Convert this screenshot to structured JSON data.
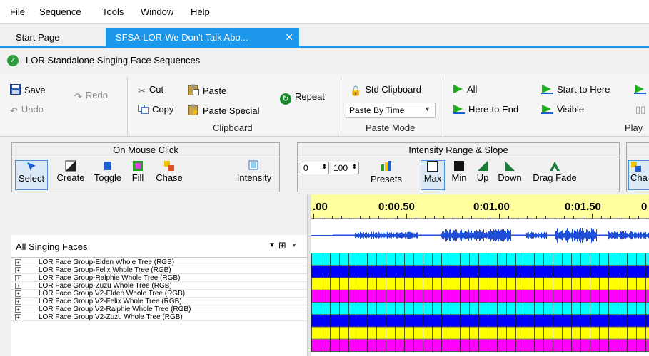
{
  "menu": [
    "File",
    "Sequence",
    "Tools",
    "Window",
    "Help"
  ],
  "tabs": {
    "start": "Start Page",
    "active": "SFSA-LOR-We Don't Talk Abo...",
    "close": "✕"
  },
  "title": "LOR Standalone Singing Face Sequences",
  "ribbon": {
    "save": "Save",
    "undo": "Undo",
    "redo": "Redo",
    "cut": "Cut",
    "copy": "Copy",
    "paste": "Paste",
    "paste_special": "Paste Special",
    "repeat": "Repeat",
    "clipboard_group": "Clipboard",
    "std_clipboard": "Std Clipboard",
    "paste_mode_value": "Paste By Time",
    "paste_mode_group": "Paste Mode",
    "play_all": "All",
    "start_to_here": "Start-to Here",
    "here_to_end": "Here-to End",
    "visible": "Visible",
    "play_group": "Play"
  },
  "mouse_click": {
    "header": "On Mouse Click",
    "select": "Select",
    "create": "Create",
    "toggle": "Toggle",
    "fill": "Fill",
    "chase": "Chase",
    "intensity": "Intensity"
  },
  "intensity_range": {
    "header": "Intensity Range & Slope",
    "low_value": "0",
    "high_value": "100",
    "presets": "Presets",
    "max": "Max",
    "min": "Min",
    "up": "Up",
    "down": "Down",
    "drag_fade": "Drag Fade"
  },
  "right_cut_label": "Cha",
  "faces": {
    "selector": "All Singing Faces",
    "rows": [
      "LOR Face Group-Elden Whole Tree (RGB)",
      "LOR Face Group-Felix Whole Tree (RGB)",
      "LOR Face Group-Ralphie Whole Tree (RGB)",
      "LOR Face Group-Zuzu Whole Tree (RGB)",
      "LOR Face Group V2-Elden Whole Tree (RGB)",
      "LOR Face Group V2-Felix Whole Tree (RGB)",
      "LOR Face Group V2-Ralphie Whole Tree (RGB)",
      "LOR Face Group V2-Zuzu Whole Tree (RGB)"
    ],
    "row_colors": [
      "#00ffff",
      "#0000ff",
      "#ffff00",
      "#ff00ff",
      "#00ffff",
      "#0000ff",
      "#ffff00",
      "#ff00ff"
    ]
  },
  "ruler_labels": [
    ".00",
    "0:00.50",
    "0:01.00",
    "0:01.50",
    "0"
  ],
  "colors": {
    "accent": "#1c97ea",
    "ruler": "#ffff9e",
    "waveform": "#1f4fd8"
  }
}
